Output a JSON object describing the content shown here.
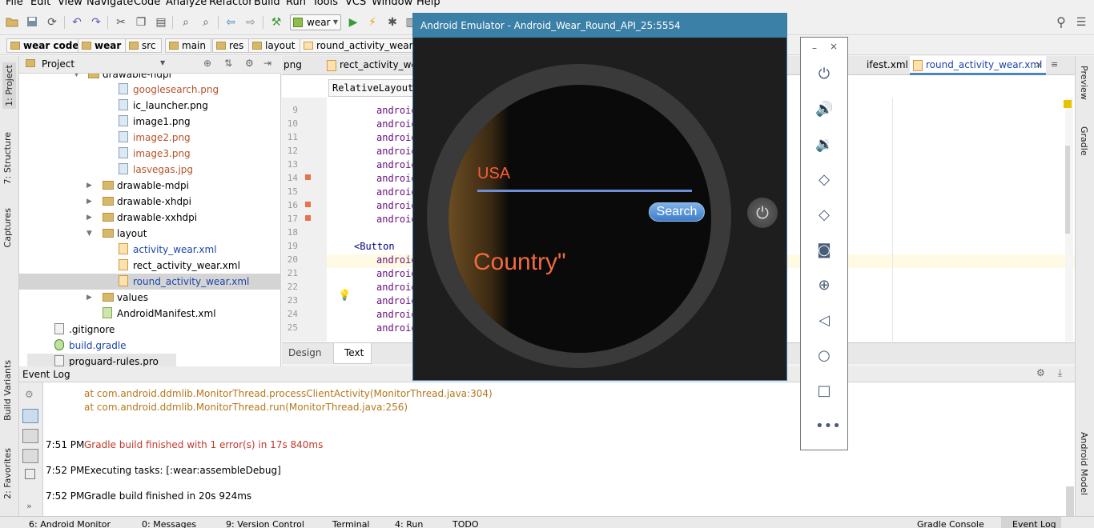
{
  "menu": [
    "File",
    "Edit",
    "View",
    "Navigate",
    "Code",
    "Analyze",
    "Refactor",
    "Build",
    "Run",
    "Tools",
    "VCS",
    "Window",
    "Help"
  ],
  "toolbar": {
    "module": "wear"
  },
  "breadcrumbs": [
    "wear code",
    "wear",
    "src",
    "main",
    "res",
    "layout",
    "round_activity_wear.xml"
  ],
  "left_strip": {
    "project": "1: Project",
    "structure": "7: Structure",
    "captures": "Captures",
    "build_variants": "Build Variants",
    "favorites": "2: Favorites"
  },
  "right_strip": {
    "preview": "Preview",
    "gradle": "Gradle",
    "android_model": "Android Model"
  },
  "project_panel": {
    "header": "Project",
    "items": [
      {
        "label": "drawable-hdpi",
        "kind": "folder"
      },
      {
        "label": "googlesearch.png",
        "kind": "image",
        "color": "#b5532a"
      },
      {
        "label": "ic_launcher.png",
        "kind": "image",
        "color": "#000000"
      },
      {
        "label": "image1.png",
        "kind": "image",
        "color": "#000000"
      },
      {
        "label": "image2.png",
        "kind": "image",
        "color": "#b5532a"
      },
      {
        "label": "image3.png",
        "kind": "image",
        "color": "#b5532a"
      },
      {
        "label": "lasvegas.jpg",
        "kind": "image",
        "color": "#b5532a"
      },
      {
        "label": "drawable-mdpi",
        "kind": "folder"
      },
      {
        "label": "drawable-xhdpi",
        "kind": "folder"
      },
      {
        "label": "drawable-xxhdpi",
        "kind": "folder"
      },
      {
        "label": "layout",
        "kind": "folder"
      },
      {
        "label": "activity_wear.xml",
        "kind": "xml",
        "color": "#1a45a8"
      },
      {
        "label": "rect_activity_wear.xml",
        "kind": "xml",
        "color": "#000000"
      },
      {
        "label": "round_activity_wear.xml",
        "kind": "xml",
        "color": "#1a45a8"
      },
      {
        "label": "values",
        "kind": "folder"
      },
      {
        "label": "AndroidManifest.xml",
        "kind": "manifest"
      },
      {
        "label": ".gitignore",
        "kind": "file"
      },
      {
        "label": "build.gradle",
        "kind": "gradle",
        "color": "#1a45a8"
      },
      {
        "label": "proguard-rules.pro",
        "kind": "file"
      }
    ]
  },
  "editor": {
    "tabs": [
      "png",
      "rect_activity_wear",
      "ifest.xml",
      "round_activity_wear.xml"
    ],
    "breadcrumb": "RelativeLayout",
    "line_numbers": [
      "9",
      "10",
      "11",
      "12",
      "13",
      "14",
      "15",
      "16",
      "17",
      "18",
      "19",
      "20",
      "21",
      "22",
      "23",
      "24",
      "25"
    ],
    "code_word": "android",
    "button_tag": "<Button",
    "design_tab": "Design",
    "text_tab": "Text"
  },
  "event_log": {
    "title": "Event Log",
    "trace": [
      "at com.android.ddmlib.MonitorThread.processClientActivity(MonitorThread.java:304)",
      "at com.android.ddmlib.MonitorThread.run(MonitorThread.java:256)"
    ],
    "entries": [
      {
        "time": "7:51 PM",
        "text": "Gradle build finished with 1 error(s) in 17s 840ms",
        "color": "#c0392b"
      },
      {
        "time": "7:52 PM",
        "text": "Executing tasks: [:wear:assembleDebug]",
        "color": "#000000"
      },
      {
        "time": "7:52 PM",
        "text": "Gradle build finished in 20s 924ms",
        "color": "#000000"
      }
    ]
  },
  "statusbar": [
    "6: Android Monitor",
    "0: Messages",
    "9: Version Control",
    "Terminal",
    "4: Run",
    "TODO",
    "Gradle Console",
    "Event Log"
  ],
  "emulator": {
    "title": "Android Emulator - Android_Wear_Round_API_25:5554",
    "field_text": "USA",
    "search_label": "Search",
    "country_label": "Country\""
  }
}
